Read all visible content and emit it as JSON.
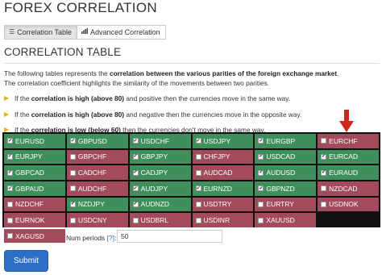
{
  "page_title": "FOREX CORRELATION",
  "tabs": [
    {
      "label": "Correlation Table",
      "icon": "list-icon",
      "active": true
    },
    {
      "label": "Advanced Correlation",
      "icon": "bar-chart-icon",
      "active": false
    }
  ],
  "section_title": "CORRELATION TABLE",
  "intro": {
    "line1_a": "The following tables represents the ",
    "line1_b": "correlation between the various parities of the foreign exchange market",
    "line1_c": ".",
    "line2": "The correlation coefficient highlights the similarity of the movements between two parities."
  },
  "bullets": [
    {
      "a": "If the ",
      "b": "correlation is high (above 80)",
      "c": " and positive then the currencies move in the same way."
    },
    {
      "a": "If the ",
      "b": "correlation is high (above 80)",
      "c": " and negative then the currencies move in the opposite way."
    },
    {
      "a": "If the ",
      "b": "correlation is low (below 60)",
      "c": " then the currencies don't move in the same way."
    }
  ],
  "pairs": [
    {
      "name": "EURUSD",
      "checked": true,
      "status": "green"
    },
    {
      "name": "GBPUSD",
      "checked": true,
      "status": "green"
    },
    {
      "name": "USDCHF",
      "checked": true,
      "status": "green"
    },
    {
      "name": "USDJPY",
      "checked": true,
      "status": "green"
    },
    {
      "name": "EURGBP",
      "checked": true,
      "status": "green"
    },
    {
      "name": "EURCHF",
      "checked": false,
      "status": "red"
    },
    {
      "name": "EURJPY",
      "checked": true,
      "status": "green"
    },
    {
      "name": "GBPCHF",
      "checked": false,
      "status": "red"
    },
    {
      "name": "GBPJPY",
      "checked": true,
      "status": "green"
    },
    {
      "name": "CHFJPY",
      "checked": false,
      "status": "red"
    },
    {
      "name": "USDCAD",
      "checked": true,
      "status": "green"
    },
    {
      "name": "EURCAD",
      "checked": true,
      "status": "green"
    },
    {
      "name": "GBPCAD",
      "checked": true,
      "status": "green"
    },
    {
      "name": "CADCHF",
      "checked": false,
      "status": "red"
    },
    {
      "name": "CADJPY",
      "checked": true,
      "status": "green"
    },
    {
      "name": "AUDCAD",
      "checked": false,
      "status": "red"
    },
    {
      "name": "AUDUSD",
      "checked": true,
      "status": "green"
    },
    {
      "name": "EURAUD",
      "checked": true,
      "status": "green"
    },
    {
      "name": "GBPAUD",
      "checked": true,
      "status": "green"
    },
    {
      "name": "AUDCHF",
      "checked": false,
      "status": "red"
    },
    {
      "name": "AUDJPY",
      "checked": true,
      "status": "green"
    },
    {
      "name": "EURNZD",
      "checked": true,
      "status": "green"
    },
    {
      "name": "GBPNZD",
      "checked": true,
      "status": "green"
    },
    {
      "name": "NZDCAD",
      "checked": false,
      "status": "red"
    },
    {
      "name": "NZDCHF",
      "checked": false,
      "status": "red"
    },
    {
      "name": "NZDJPY",
      "checked": true,
      "status": "green"
    },
    {
      "name": "AUDNZD",
      "checked": true,
      "status": "green"
    },
    {
      "name": "USDTRY",
      "checked": false,
      "status": "red"
    },
    {
      "name": "EURTRY",
      "checked": false,
      "status": "red"
    },
    {
      "name": "USDNOK",
      "checked": false,
      "status": "red"
    },
    {
      "name": "EURNOK",
      "checked": false,
      "status": "red"
    },
    {
      "name": "USDCNY",
      "checked": false,
      "status": "red"
    },
    {
      "name": "USDBRL",
      "checked": false,
      "status": "red"
    },
    {
      "name": "USDINR",
      "checked": false,
      "status": "red"
    },
    {
      "name": "XAUUSD",
      "checked": false,
      "status": "red"
    },
    {
      "name": "XAGUSD",
      "checked": false,
      "status": "red"
    }
  ],
  "num_periods": {
    "label": "Num periods",
    "help": "[?]",
    "suffix": ":",
    "value": "50"
  },
  "submit_label": "Submit",
  "colors": {
    "green": "#3f8f5c",
    "red": "#a24b5d",
    "arrow": "#d0261f",
    "button": "#2d6fc6",
    "bullet_arrow": "#f0ad1e"
  },
  "annotation_arrow": "red-down-arrow-icon"
}
